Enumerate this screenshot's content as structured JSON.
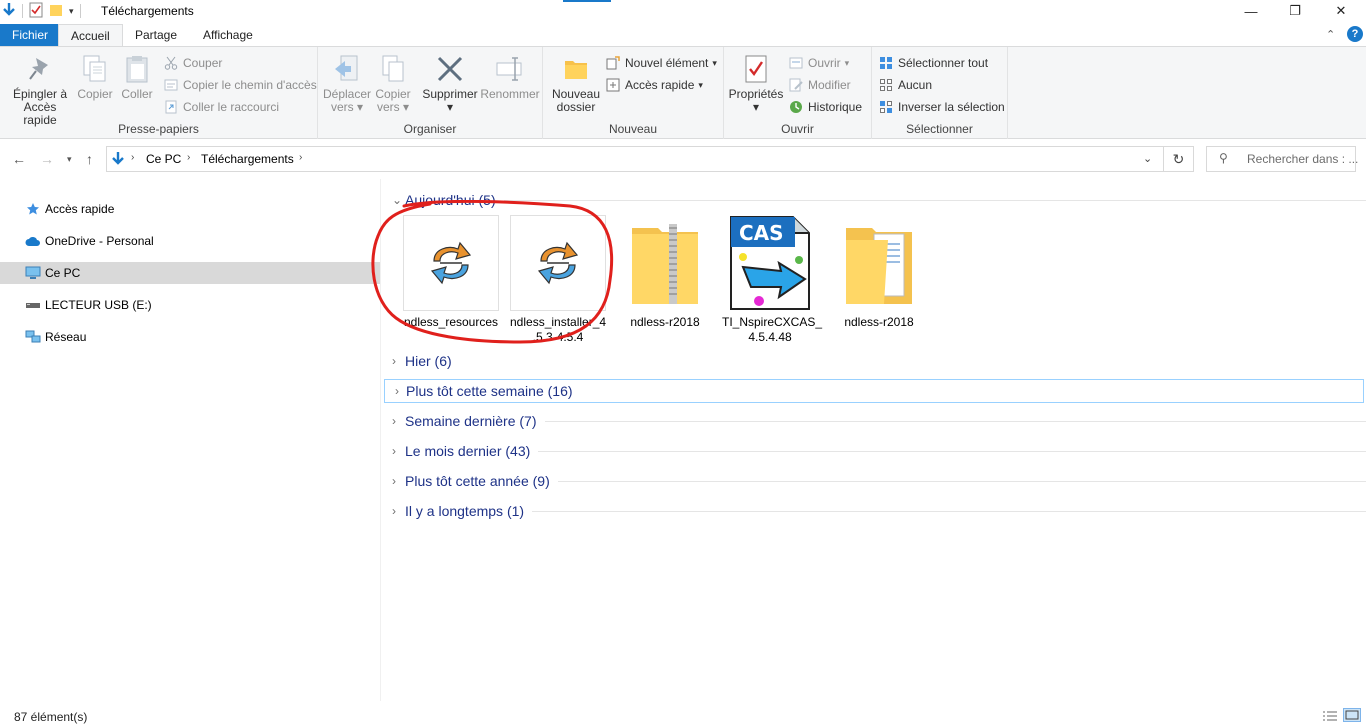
{
  "window": {
    "title": "Téléchargements",
    "minimize": "—",
    "maximize": "❐",
    "close": "✕"
  },
  "ribbon_tabs": {
    "file": "Fichier",
    "home": "Accueil",
    "share": "Partage",
    "view": "Affichage"
  },
  "ribbon": {
    "clipboard": {
      "label": "Presse-papiers",
      "pin": "Épingler à",
      "pin2": "Accès rapide",
      "copy": "Copier",
      "paste": "Coller",
      "cut": "Couper",
      "copy_path": "Copier le chemin d'accès",
      "paste_shortcut": "Coller le raccourci"
    },
    "organize": {
      "label": "Organiser",
      "move": "Déplacer",
      "move2": "vers",
      "copyto": "Copier",
      "copyto2": "vers",
      "delete": "Supprimer",
      "rename": "Renommer"
    },
    "new": {
      "label": "Nouveau",
      "new_folder": "Nouveau",
      "new_folder2": "dossier",
      "new_item": "Nouvel élément",
      "easy_access": "Accès rapide"
    },
    "open": {
      "label": "Ouvrir",
      "properties": "Propriétés",
      "open": "Ouvrir",
      "edit": "Modifier",
      "history": "Historique"
    },
    "select": {
      "label": "Sélectionner",
      "select_all": "Sélectionner tout",
      "select_none": "Aucun",
      "invert": "Inverser la sélection"
    }
  },
  "address": {
    "segments": [
      "Ce PC",
      "Téléchargements"
    ],
    "search_placeholder": "Rechercher dans : ..."
  },
  "sidebar": {
    "items": [
      {
        "label": "Accès rapide"
      },
      {
        "label": "OneDrive - Personal"
      },
      {
        "label": "Ce PC"
      },
      {
        "label": "LECTEUR USB (E:)"
      },
      {
        "label": "Réseau"
      }
    ]
  },
  "content": {
    "groups": [
      {
        "label": "Aujourd'hui (5)"
      },
      {
        "label": "Hier (6)"
      },
      {
        "label": "Plus tôt cette semaine (16)"
      },
      {
        "label": "Semaine dernière (7)"
      },
      {
        "label": "Le mois dernier (43)"
      },
      {
        "label": "Plus tôt cette année (9)"
      },
      {
        "label": "Il y a longtemps (1)"
      }
    ],
    "files": [
      {
        "name": "ndless_resources"
      },
      {
        "name": "ndless_installer_4",
        "name2": ".5.3-4.5.4"
      },
      {
        "name": "ndless-r2018"
      },
      {
        "name": "TI_NspireCXCAS_",
        "name2": "4.5.4.48",
        "badge": "CAS"
      },
      {
        "name": "ndless-r2018"
      }
    ]
  },
  "status": {
    "count": "87 élément(s)"
  },
  "colors": {
    "accent": "#1979ca",
    "group_text": "#1e3287",
    "annotation": "#e0201c"
  }
}
